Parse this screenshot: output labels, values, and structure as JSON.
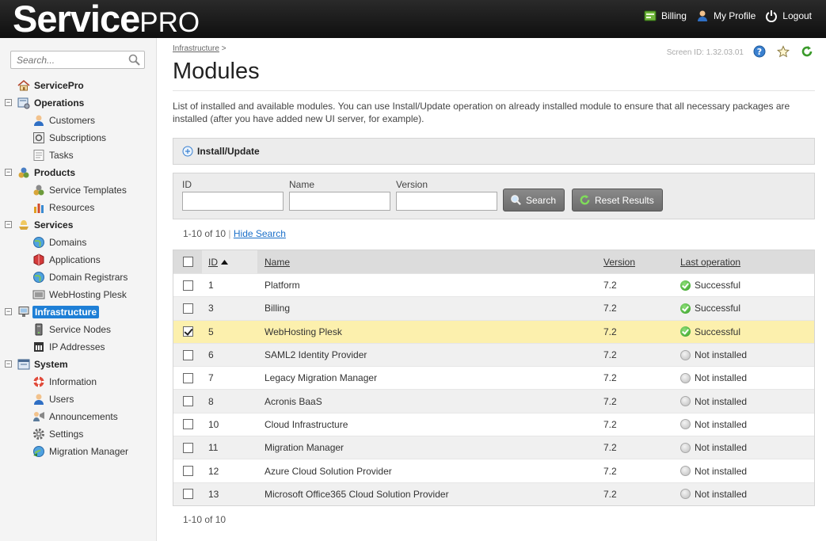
{
  "header": {
    "brand_main": "Service",
    "brand_sub": "PRO",
    "nav": [
      {
        "label": "Billing",
        "icon": "billing-icon"
      },
      {
        "label": "My Profile",
        "icon": "user-icon"
      },
      {
        "label": "Logout",
        "icon": "power-icon"
      }
    ]
  },
  "sidebar": {
    "search_placeholder": "Search...",
    "items": [
      {
        "label": "ServicePro",
        "level": 0,
        "icon": "home-icon"
      },
      {
        "label": "Operations",
        "level": 0,
        "icon": "operations-icon",
        "toggle": "−"
      },
      {
        "label": "Customers",
        "level": 1,
        "icon": "customer-icon"
      },
      {
        "label": "Subscriptions",
        "level": 1,
        "icon": "subscription-icon"
      },
      {
        "label": "Tasks",
        "level": 1,
        "icon": "tasks-icon"
      },
      {
        "label": "Products",
        "level": 0,
        "icon": "products-icon",
        "toggle": "−"
      },
      {
        "label": "Service Templates",
        "level": 1,
        "icon": "templates-icon"
      },
      {
        "label": "Resources",
        "level": 1,
        "icon": "resources-icon"
      },
      {
        "label": "Services",
        "level": 0,
        "icon": "services-icon",
        "toggle": "−"
      },
      {
        "label": "Domains",
        "level": 1,
        "icon": "globe-icon"
      },
      {
        "label": "Applications",
        "level": 1,
        "icon": "applications-icon"
      },
      {
        "label": "Domain Registrars",
        "level": 1,
        "icon": "globe-icon"
      },
      {
        "label": "WebHosting Plesk",
        "level": 1,
        "icon": "webhosting-icon"
      },
      {
        "label": "Infrastructure",
        "level": 0,
        "icon": "infrastructure-icon",
        "toggle": "−",
        "selected": true
      },
      {
        "label": "Service Nodes",
        "level": 1,
        "icon": "server-icon"
      },
      {
        "label": "IP Addresses",
        "level": 1,
        "icon": "ip-icon"
      },
      {
        "label": "System",
        "level": 0,
        "icon": "system-icon",
        "toggle": "−"
      },
      {
        "label": "Information",
        "level": 1,
        "icon": "lifebuoy-icon"
      },
      {
        "label": "Users",
        "level": 1,
        "icon": "user-icon"
      },
      {
        "label": "Announcements",
        "level": 1,
        "icon": "announcements-icon"
      },
      {
        "label": "Settings",
        "level": 1,
        "icon": "gear-icon"
      },
      {
        "label": "Migration Manager",
        "level": 1,
        "icon": "migration-icon"
      }
    ]
  },
  "main": {
    "breadcrumb": "Infrastructure",
    "breadcrumb_sep": ">",
    "screen_id": "Screen ID:  1.32.03.01",
    "title": "Modules",
    "description": "List of installed and available modules. You can use Install/Update operation on already installed module to ensure that all necessary packages are installed (after you have added new UI server, for example).",
    "toolbar": {
      "install_label": "Install/Update"
    },
    "filters": {
      "id_label": "ID",
      "name_label": "Name",
      "version_label": "Version",
      "search_label": "Search",
      "reset_label": "Reset Results"
    },
    "count_text": "1-10 of 10",
    "count_sep": "|",
    "hide_search": "Hide Search",
    "table": {
      "headers": {
        "id": "ID",
        "name": "Name",
        "version": "Version",
        "last_op": "Last operation"
      },
      "rows": [
        {
          "id": "1",
          "name": "Platform",
          "version": "7.2",
          "status": "Successful",
          "ok": true,
          "checked": false
        },
        {
          "id": "3",
          "name": "Billing",
          "version": "7.2",
          "status": "Successful",
          "ok": true,
          "checked": false
        },
        {
          "id": "5",
          "name": "WebHosting Plesk",
          "version": "7.2",
          "status": "Successful",
          "ok": true,
          "checked": true
        },
        {
          "id": "6",
          "name": "SAML2 Identity Provider",
          "version": "7.2",
          "status": "Not installed",
          "ok": false,
          "checked": false
        },
        {
          "id": "7",
          "name": "Legacy Migration Manager",
          "version": "7.2",
          "status": "Not installed",
          "ok": false,
          "checked": false
        },
        {
          "id": "8",
          "name": "Acronis BaaS",
          "version": "7.2",
          "status": "Not installed",
          "ok": false,
          "checked": false
        },
        {
          "id": "10",
          "name": "Cloud Infrastructure",
          "version": "7.2",
          "status": "Not installed",
          "ok": false,
          "checked": false
        },
        {
          "id": "11",
          "name": "Migration Manager",
          "version": "7.2",
          "status": "Not installed",
          "ok": false,
          "checked": false
        },
        {
          "id": "12",
          "name": "Azure Cloud Solution Provider",
          "version": "7.2",
          "status": "Not installed",
          "ok": false,
          "checked": false
        },
        {
          "id": "13",
          "name": "Microsoft Office365 Cloud Solution Provider",
          "version": "7.2",
          "status": "Not installed",
          "ok": false,
          "checked": false
        }
      ]
    },
    "footer_count": "1-10 of 10"
  }
}
